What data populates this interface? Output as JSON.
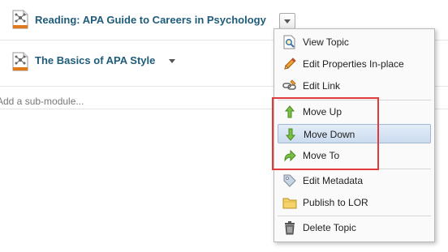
{
  "topics": [
    {
      "title": "Reading: APA Guide to Careers in Psychology"
    },
    {
      "title": "The Basics of APA Style"
    }
  ],
  "submodule": {
    "placeholder": "Add a sub-module..."
  },
  "menu": {
    "groups": [
      [
        {
          "label": "View Topic",
          "icon": "view-topic-icon"
        },
        {
          "label": "Edit Properties In-place",
          "icon": "pencil-icon"
        },
        {
          "label": "Edit Link",
          "icon": "link-icon"
        }
      ],
      [
        {
          "label": "Move Up",
          "icon": "arrow-up-icon"
        },
        {
          "label": "Move Down",
          "icon": "arrow-down-icon"
        },
        {
          "label": "Move To",
          "icon": "move-to-icon"
        }
      ],
      [
        {
          "label": "Edit Metadata",
          "icon": "tag-icon"
        },
        {
          "label": "Publish to LOR",
          "icon": "folder-icon"
        }
      ],
      [
        {
          "label": "Delete Topic",
          "icon": "trash-icon"
        }
      ]
    ],
    "hovered_item": "Move Down"
  },
  "colors": {
    "topic_title": "#1f5c7a",
    "highlight_border": "#e03a3a",
    "hover_bg": "#cbdcef"
  }
}
